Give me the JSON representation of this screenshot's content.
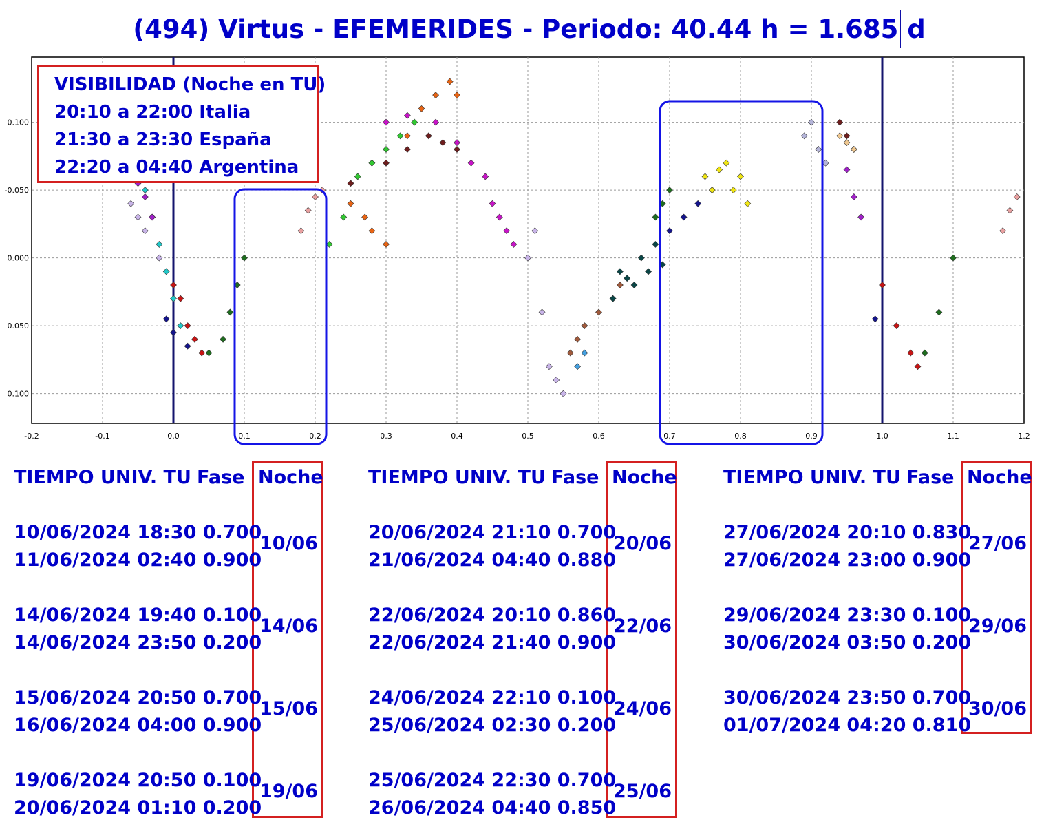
{
  "title": "(494) Virtus - EFEMERIDES - Periodo: 40.44 h = 1.685 d",
  "visibility": {
    "lines": [
      "VISIBILIDAD (Noche en TU)",
      "20:10 a 22:00 Italia",
      "21:30 a 23:30 España",
      "22:20 a 04:40 Argentina"
    ]
  },
  "chart_data": {
    "type": "scatter",
    "title": "",
    "xlabel": "",
    "ylabel": "",
    "xlim": [
      -0.2,
      1.2
    ],
    "ylim": [
      0.122,
      -0.148
    ],
    "y_inverted": true,
    "grid": true,
    "x_ticks": [
      "-0.2",
      "-0.1",
      "0.0",
      "0.1",
      "0.2",
      "0.3",
      "0.4",
      "0.5",
      "0.6",
      "0.7",
      "0.8",
      "0.9",
      "1.0",
      "1.1",
      "1.2"
    ],
    "y_ticks": [
      "-0.100",
      "-0.050",
      "0.000",
      "0.050",
      "0.100"
    ],
    "vertical_lines": [
      0.0,
      1.0
    ],
    "highlight_windows": [
      [
        0.1,
        0.2
      ],
      [
        0.7,
        0.9
      ]
    ],
    "series": [
      {
        "color": "#20c8c8",
        "points": [
          [
            -0.04,
            -0.05
          ],
          [
            -0.03,
            -0.03
          ],
          [
            -0.02,
            -0.01
          ],
          [
            -0.01,
            0.01
          ],
          [
            0.0,
            0.03
          ],
          [
            0.01,
            0.05
          ]
        ]
      },
      {
        "color": "#c8b4e8",
        "points": [
          [
            -0.06,
            -0.04
          ],
          [
            -0.05,
            -0.03
          ],
          [
            -0.04,
            -0.02
          ],
          [
            -0.02,
            0.0
          ],
          [
            0.5,
            -0.0
          ],
          [
            0.51,
            -0.02
          ],
          [
            0.52,
            0.04
          ],
          [
            0.53,
            0.08
          ],
          [
            0.54,
            0.09
          ],
          [
            0.55,
            0.1
          ]
        ]
      },
      {
        "color": "#a020c8",
        "points": [
          [
            -0.05,
            -0.055
          ],
          [
            -0.04,
            -0.045
          ],
          [
            -0.03,
            -0.03
          ],
          [
            0.95,
            -0.065
          ],
          [
            0.96,
            -0.045
          ],
          [
            0.97,
            -0.03
          ]
        ]
      },
      {
        "color": "#c81414",
        "points": [
          [
            0.0,
            0.02
          ],
          [
            0.01,
            0.03
          ],
          [
            0.02,
            0.05
          ],
          [
            0.03,
            0.06
          ],
          [
            0.04,
            0.07
          ],
          [
            1.0,
            0.02
          ],
          [
            1.02,
            0.05
          ],
          [
            1.04,
            0.07
          ],
          [
            1.05,
            0.08
          ]
        ]
      },
      {
        "color": "#14148c",
        "points": [
          [
            -0.01,
            0.045
          ],
          [
            0.0,
            0.055
          ],
          [
            0.02,
            0.065
          ],
          [
            0.7,
            -0.02
          ],
          [
            0.72,
            -0.03
          ],
          [
            0.74,
            -0.04
          ],
          [
            0.76,
            -0.05
          ],
          [
            0.99,
            0.045
          ]
        ]
      },
      {
        "color": "#1e6e1e",
        "points": [
          [
            0.05,
            0.07
          ],
          [
            0.07,
            0.06
          ],
          [
            0.08,
            0.04
          ],
          [
            0.09,
            0.02
          ],
          [
            0.1,
            0.0
          ],
          [
            0.68,
            -0.03
          ],
          [
            0.69,
            -0.04
          ],
          [
            0.7,
            -0.05
          ],
          [
            1.06,
            0.07
          ],
          [
            1.08,
            0.04
          ],
          [
            1.1,
            0.0
          ]
        ]
      },
      {
        "color": "#e8a0a0",
        "points": [
          [
            0.18,
            -0.02
          ],
          [
            0.19,
            -0.035
          ],
          [
            0.2,
            -0.045
          ],
          [
            0.21,
            -0.05
          ],
          [
            1.17,
            -0.02
          ],
          [
            1.18,
            -0.035
          ],
          [
            1.19,
            -0.045
          ]
        ]
      },
      {
        "color": "#6e1e1e",
        "points": [
          [
            0.25,
            -0.055
          ],
          [
            0.28,
            -0.07
          ],
          [
            0.3,
            -0.07
          ],
          [
            0.33,
            -0.08
          ],
          [
            0.36,
            -0.09
          ],
          [
            0.38,
            -0.085
          ],
          [
            0.4,
            -0.08
          ],
          [
            0.94,
            -0.1
          ],
          [
            0.95,
            -0.09
          ],
          [
            0.96,
            -0.08
          ]
        ]
      },
      {
        "color": "#e86414",
        "points": [
          [
            0.25,
            -0.04
          ],
          [
            0.27,
            -0.03
          ],
          [
            0.28,
            -0.02
          ],
          [
            0.3,
            -0.01
          ],
          [
            0.33,
            -0.09
          ],
          [
            0.35,
            -0.11
          ],
          [
            0.37,
            -0.12
          ],
          [
            0.39,
            -0.13
          ],
          [
            0.4,
            -0.12
          ]
        ]
      },
      {
        "color": "#32c832",
        "points": [
          [
            0.22,
            -0.01
          ],
          [
            0.24,
            -0.03
          ],
          [
            0.26,
            -0.06
          ],
          [
            0.28,
            -0.07
          ],
          [
            0.3,
            -0.08
          ],
          [
            0.32,
            -0.09
          ],
          [
            0.34,
            -0.1
          ]
        ]
      },
      {
        "color": "#c814c8",
        "points": [
          [
            0.3,
            -0.1
          ],
          [
            0.33,
            -0.105
          ],
          [
            0.37,
            -0.1
          ],
          [
            0.4,
            -0.085
          ],
          [
            0.42,
            -0.07
          ],
          [
            0.44,
            -0.06
          ],
          [
            0.45,
            -0.04
          ],
          [
            0.46,
            -0.03
          ],
          [
            0.47,
            -0.02
          ],
          [
            0.48,
            -0.01
          ]
        ]
      },
      {
        "color": "#a05a3c",
        "points": [
          [
            0.56,
            0.07
          ],
          [
            0.57,
            0.06
          ],
          [
            0.58,
            0.05
          ],
          [
            0.6,
            0.04
          ],
          [
            0.62,
            0.03
          ],
          [
            0.63,
            0.02
          ]
        ]
      },
      {
        "color": "#0a4646",
        "points": [
          [
            0.62,
            0.03
          ],
          [
            0.63,
            0.01
          ],
          [
            0.64,
            0.015
          ],
          [
            0.65,
            0.02
          ],
          [
            0.66,
            0.0
          ],
          [
            0.67,
            0.01
          ],
          [
            0.68,
            -0.01
          ],
          [
            0.69,
            0.005
          ]
        ]
      },
      {
        "color": "#f0e614",
        "points": [
          [
            0.75,
            -0.06
          ],
          [
            0.76,
            -0.05
          ],
          [
            0.77,
            -0.065
          ],
          [
            0.78,
            -0.07
          ],
          [
            0.79,
            -0.05
          ],
          [
            0.8,
            -0.06
          ],
          [
            0.81,
            -0.04
          ]
        ]
      },
      {
        "color": "#b4b4d8",
        "points": [
          [
            0.89,
            -0.09
          ],
          [
            0.9,
            -0.1
          ],
          [
            0.91,
            -0.08
          ],
          [
            0.92,
            -0.07
          ]
        ]
      },
      {
        "color": "#f0c890",
        "points": [
          [
            0.94,
            -0.09
          ],
          [
            0.95,
            -0.085
          ],
          [
            0.96,
            -0.08
          ]
        ]
      },
      {
        "color": "#44a0e0",
        "points": [
          [
            0.57,
            0.08
          ],
          [
            0.58,
            0.07
          ]
        ]
      }
    ]
  },
  "columns": [
    {
      "h_tiempo": "TIEMPO UNIV. TU",
      "h_fase": "Fase",
      "h_noche": "Noche",
      "rows": [
        {
          "d1": "10/06/2024",
          "t1": "18:30",
          "f1": "0.700",
          "d2": "11/06/2024",
          "t2": "02:40",
          "f2": "0.900",
          "night": "10/06"
        },
        {
          "d1": "14/06/2024",
          "t1": "19:40",
          "f1": "0.100",
          "d2": "14/06/2024",
          "t2": "23:50",
          "f2": "0.200",
          "night": "14/06"
        },
        {
          "d1": "15/06/2024",
          "t1": "20:50",
          "f1": "0.700",
          "d2": "16/06/2024",
          "t2": "04:00",
          "f2": "0.900",
          "night": "15/06"
        },
        {
          "d1": "19/06/2024",
          "t1": "20:50",
          "f1": "0.100",
          "d2": "20/06/2024",
          "t2": "01:10",
          "f2": "0.200",
          "night": "19/06"
        }
      ]
    },
    {
      "h_tiempo": "TIEMPO UNIV. TU",
      "h_fase": "Fase",
      "h_noche": "Noche",
      "rows": [
        {
          "d1": "20/06/2024",
          "t1": "21:10",
          "f1": "0.700",
          "d2": "21/06/2024",
          "t2": "04:40",
          "f2": "0.880",
          "night": "20/06"
        },
        {
          "d1": "22/06/2024",
          "t1": "20:10",
          "f1": "0.860",
          "d2": "22/06/2024",
          "t2": "21:40",
          "f2": "0.900",
          "night": "22/06"
        },
        {
          "d1": "24/06/2024",
          "t1": "22:10",
          "f1": "0.100",
          "d2": "25/06/2024",
          "t2": "02:30",
          "f2": "0.200",
          "night": "24/06"
        },
        {
          "d1": "25/06/2024",
          "t1": "22:30",
          "f1": "0.700",
          "d2": "26/06/2024",
          "t2": "04:40",
          "f2": "0.850",
          "night": "25/06"
        }
      ]
    },
    {
      "h_tiempo": "TIEMPO UNIV. TU",
      "h_fase": "Fase",
      "h_noche": "Noche",
      "rows": [
        {
          "d1": "27/06/2024",
          "t1": "20:10",
          "f1": "0.830",
          "d2": "27/06/2024",
          "t2": "23:00",
          "f2": "0.900",
          "night": "27/06"
        },
        {
          "d1": "29/06/2024",
          "t1": "23:30",
          "f1": "0.100",
          "d2": "30/06/2024",
          "t2": "03:50",
          "f2": "0.200",
          "night": "29/06"
        },
        {
          "d1": "30/06/2024",
          "t1": "23:50",
          "f1": "0.700",
          "d2": "01/07/2024",
          "t2": "04:20",
          "f2": "0.810",
          "night": "30/06"
        }
      ]
    }
  ]
}
